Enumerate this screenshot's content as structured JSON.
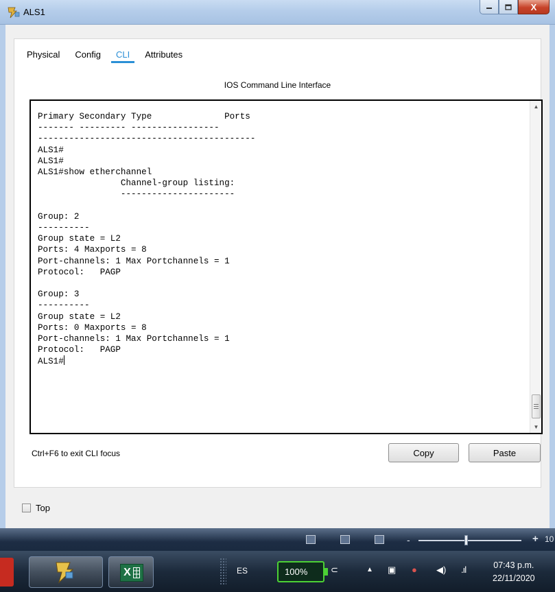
{
  "window": {
    "title": "ALS1",
    "icons": {
      "app": "packet-tracer-switch-icon",
      "minimize": "minimize-icon",
      "maximize": "maximize-icon",
      "close": "close-icon"
    },
    "close_label": "X"
  },
  "tabs": [
    {
      "label": "Physical",
      "active": false
    },
    {
      "label": "Config",
      "active": false
    },
    {
      "label": "CLI",
      "active": true
    },
    {
      "label": "Attributes",
      "active": false
    }
  ],
  "cli": {
    "heading": "IOS Command Line Interface",
    "lines": [
      "Primary Secondary Type              Ports",
      "------- --------- -----------------",
      "------------------------------------------",
      "ALS1#",
      "ALS1#",
      "ALS1#show etherchannel",
      "                Channel-group listing:",
      "                ----------------------",
      "",
      "Group: 2",
      "----------",
      "Group state = L2",
      "Ports: 4 Maxports = 8",
      "Port-channels: 1 Max Portchannels = 1",
      "Protocol:   PAGP",
      "",
      "Group: 3",
      "----------",
      "Group state = L2",
      "Ports: 0 Maxports = 8",
      "Port-channels: 1 Max Portchannels = 1",
      "Protocol:   PAGP"
    ],
    "prompt": "ALS1#",
    "hint": "Ctrl+F6 to exit CLI focus",
    "copy_label": "Copy",
    "paste_label": "Paste"
  },
  "options": {
    "top_label": "Top",
    "top_checked": false
  },
  "zoom_bar": {
    "minus": "-",
    "plus": "+",
    "value": "10"
  },
  "taskbar": {
    "apps": [
      {
        "name": "packet-tracer",
        "icon": "packet-tracer-icon"
      },
      {
        "name": "excel",
        "icon": "excel-icon",
        "label": "X"
      }
    ],
    "language": "ES",
    "battery": "100%",
    "clock": {
      "time": "07:43 p.m.",
      "date": "22/11/2020"
    },
    "tray_icons": [
      "network-icon",
      "show-hidden-icon",
      "action-center-icon",
      "chrome-disabled-icon",
      "volume-icon",
      "signal-icon"
    ]
  }
}
